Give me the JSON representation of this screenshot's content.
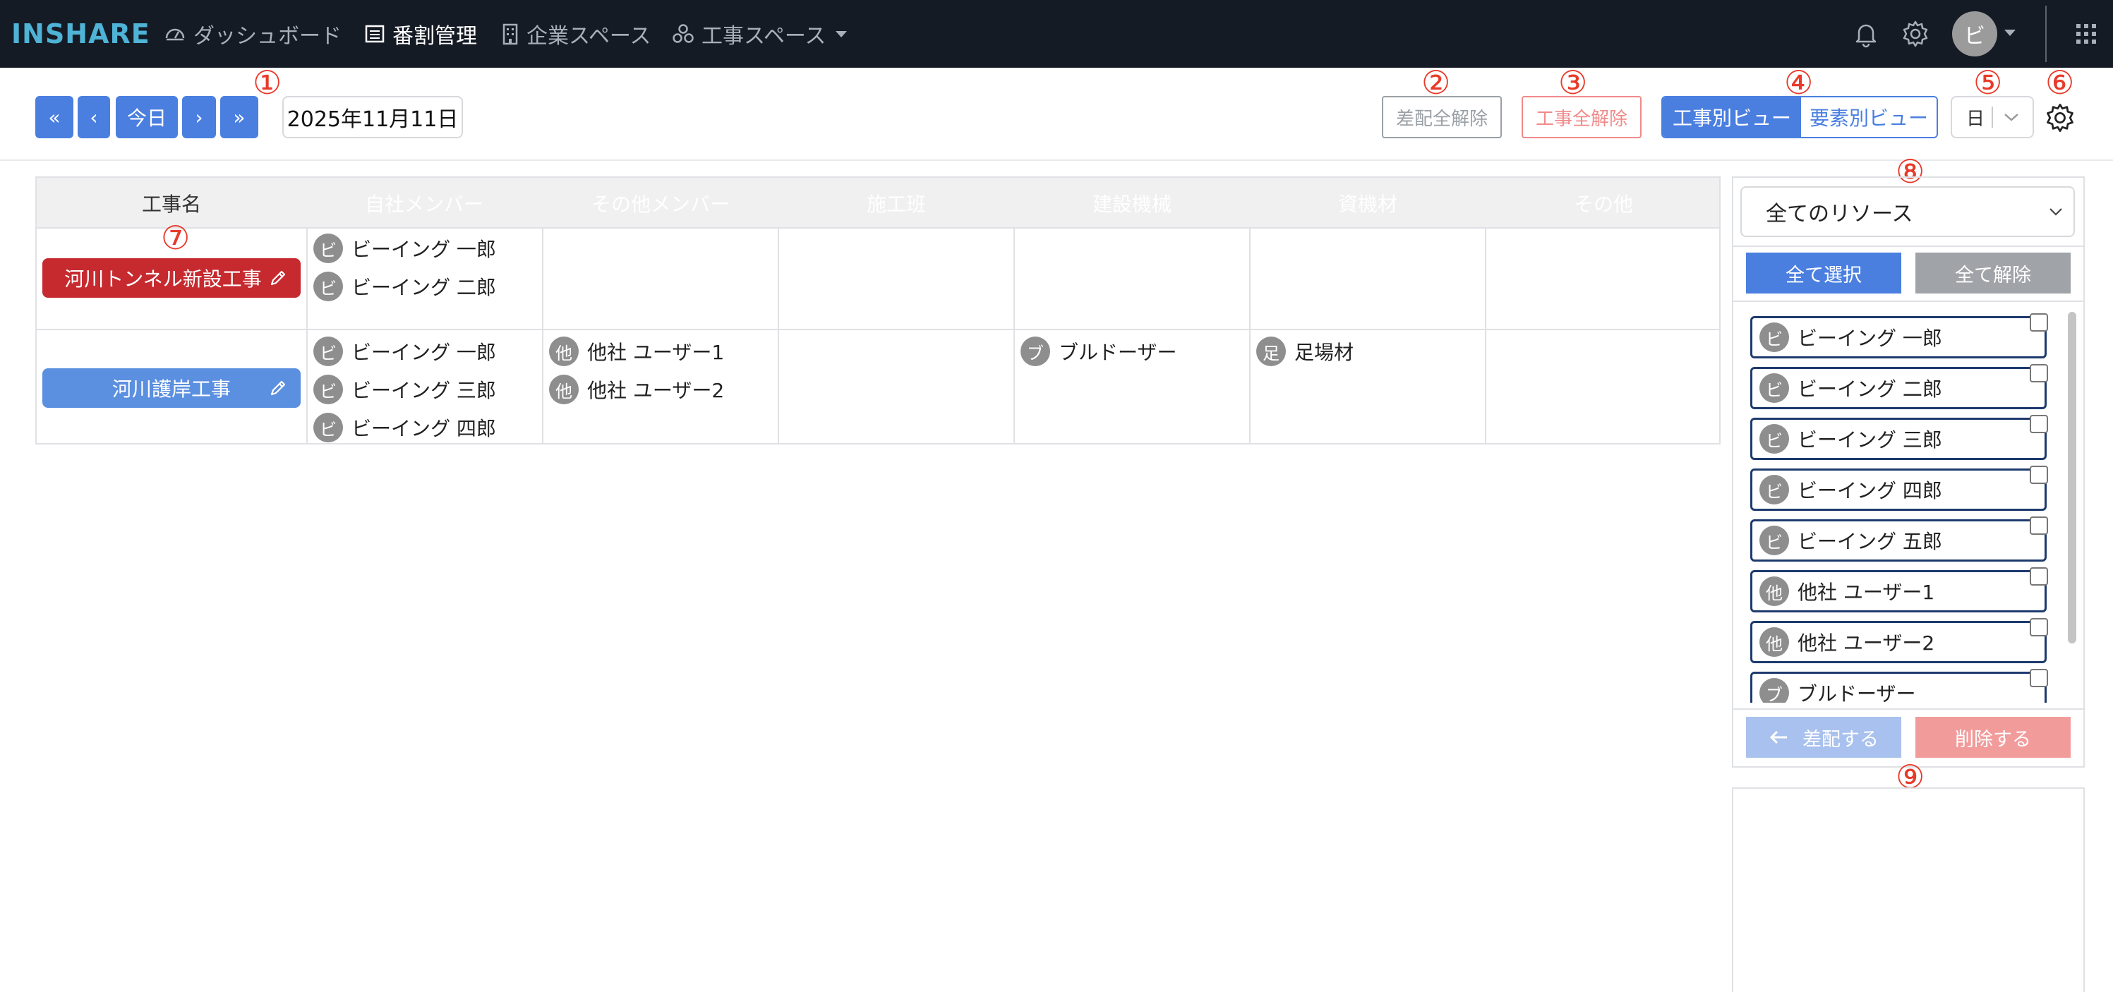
{
  "navbar": {
    "logo": "INSHARE",
    "items": [
      {
        "label": "ダッシュボード",
        "icon": "gauge-icon"
      },
      {
        "label": "番割管理",
        "icon": "list-icon",
        "active": true
      },
      {
        "label": "企業スペース",
        "icon": "building-icon"
      },
      {
        "label": "工事スペース",
        "icon": "network-icon",
        "dropdown": true
      }
    ],
    "avatar": "ビ"
  },
  "toolbar": {
    "first": "«",
    "prev": "‹",
    "today": "今日",
    "next": "›",
    "last": "»",
    "date": "2025年11月11日",
    "clear_assign": "差配全解除",
    "clear_projects": "工事全解除",
    "view_by_project": "工事別ビュー",
    "view_by_element": "要素別ビュー",
    "unit": "日"
  },
  "markers": {
    "m1": "①",
    "m2": "②",
    "m3": "③",
    "m4": "④",
    "m5": "⑤",
    "m6": "⑥",
    "m7": "⑦",
    "m8": "⑧",
    "m9": "⑨"
  },
  "table": {
    "name_header": "工事名",
    "columns": [
      {
        "label": "自社メンバー",
        "color": "#5b8fcf"
      },
      {
        "label": "その他メンバー",
        "color": "#5b8fcf"
      },
      {
        "label": "施工班",
        "color": "#5b8fcf"
      },
      {
        "label": "建設機械",
        "color": "#6aa54f"
      },
      {
        "label": "資機材",
        "color": "#6aa54f"
      },
      {
        "label": "その他",
        "color": "#e77a45"
      }
    ],
    "rows": [
      {
        "project": "河川トンネル新設工事",
        "color": "#c62a2f",
        "own": [
          {
            "badge": "ビ",
            "name": "ビーイング 一郎"
          },
          {
            "badge": "ビ",
            "name": "ビーイング 二郎"
          }
        ]
      },
      {
        "project": "河川護岸工事",
        "color": "#5b8fe0",
        "own": [
          {
            "badge": "ビ",
            "name": "ビーイング 一郎"
          },
          {
            "badge": "ビ",
            "name": "ビーイング 三郎"
          },
          {
            "badge": "ビ",
            "name": "ビーイング 四郎"
          }
        ],
        "other": [
          {
            "badge": "他",
            "name": "他社 ユーザー1"
          },
          {
            "badge": "他",
            "name": "他社 ユーザー2"
          }
        ],
        "machine": [
          {
            "badge": "ブ",
            "name": "ブルドーザー"
          }
        ],
        "material": [
          {
            "badge": "足",
            "name": "足場材"
          }
        ]
      }
    ]
  },
  "panel": {
    "filter": "全てのリソース",
    "select_all": "全て選択",
    "deselect_all": "全て解除",
    "items": [
      {
        "badge": "ビ",
        "name": "ビーイング 一郎"
      },
      {
        "badge": "ビ",
        "name": "ビーイング 二郎"
      },
      {
        "badge": "ビ",
        "name": "ビーイング 三郎"
      },
      {
        "badge": "ビ",
        "name": "ビーイング 四郎"
      },
      {
        "badge": "ビ",
        "name": "ビーイング 五郎"
      },
      {
        "badge": "他",
        "name": "他社 ユーザー1"
      },
      {
        "badge": "他",
        "name": "他社 ユーザー2"
      },
      {
        "badge": "ブ",
        "name": "ブルドーザー"
      }
    ],
    "assign": "差配する",
    "delete": "削除する"
  },
  "colors": {
    "navbar_bg": "#151b25",
    "primary": "#4a7fe0",
    "danger_outline": "#f08a8a",
    "marker": "#e83a2a"
  }
}
